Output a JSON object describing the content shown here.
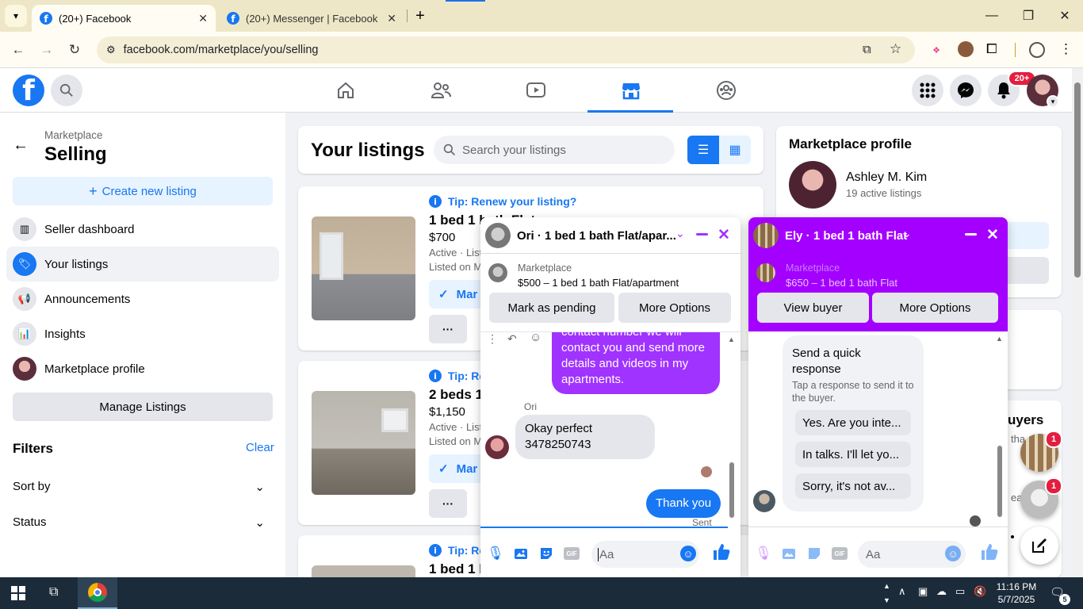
{
  "browser": {
    "tabs": [
      {
        "title": "(20+) Facebook",
        "active": true
      },
      {
        "title": "(20+) Messenger | Facebook",
        "active": false
      }
    ],
    "url": "facebook.com/marketplace/you/selling"
  },
  "header": {
    "notification_count": "20+"
  },
  "sidebar": {
    "crumb": "Marketplace",
    "title": "Selling",
    "create_label": "Create new listing",
    "items": [
      {
        "label": "Seller dashboard"
      },
      {
        "label": "Your listings"
      },
      {
        "label": "Announcements"
      },
      {
        "label": "Insights"
      },
      {
        "label": "Marketplace profile"
      }
    ],
    "manage_label": "Manage Listings",
    "filters_label": "Filters",
    "clear_label": "Clear",
    "sort_label": "Sort by",
    "status_label": "Status"
  },
  "listings": {
    "title": "Your listings",
    "search_placeholder": "Search your listings",
    "items": [
      {
        "tip": "Tip: Renew your listing?",
        "title": "1 bed 1 bath Flat",
        "price": "$700",
        "status": "Active · List",
        "listed": "Listed on M",
        "mark": "Mar",
        "more": "···"
      },
      {
        "tip": "Tip: Re",
        "title": "2 beds 1",
        "price": "$1,150",
        "status": "Active · List",
        "listed": "Listed on M",
        "mark": "Mar",
        "more": "···"
      },
      {
        "tip": "Tip: Re",
        "title": "1 bed 1 b"
      }
    ]
  },
  "profile": {
    "heading": "Marketplace profile",
    "name": "Ashley M. Kim",
    "count": "19 active listings",
    "buyers_partial": "uyers",
    "partial1": "tha",
    "partial2": "ear"
  },
  "chat1": {
    "title": "Ori · 1 bed 1 bath Flat/apar...",
    "context_label": "Marketplace",
    "context_item": "$500 – 1 bed 1 bath Flat/apartment",
    "btn_pending": "Mark as pending",
    "btn_more": "More Options",
    "msg_top_partial": "contact number we will",
    "msg_out": "contact you and send more details and videos in my apartments.",
    "sender": "Ori",
    "msg_in": "Okay perfect 3478250743",
    "msg_out2": "Thank you",
    "sent_label": "Sent",
    "input_placeholder": "Aa"
  },
  "chat2": {
    "title": "Ely · 1 bed 1 bath Flat",
    "context_label": "Marketplace",
    "context_item": "$650 – 1 bed 1 bath Flat",
    "btn_view": "View buyer",
    "btn_more": "More Options",
    "qr_title": "Send a quick response",
    "qr_sub": "Tap a response to send it to the buyer.",
    "quick_replies": [
      "Yes. Are you inte...",
      "In talks. I'll let yo...",
      "Sorry, it's not av..."
    ],
    "input_placeholder": "Aa"
  },
  "chat_heads": [
    {
      "badge": "1"
    },
    {
      "badge": "1"
    }
  ],
  "taskbar": {
    "time": "11:16 PM",
    "date": "5/7/2025",
    "notif": "5"
  },
  "colors": {
    "fb_blue": "#1877f2",
    "messenger_purple": "#a033ff",
    "chat_purple_header": "#a400ff"
  }
}
